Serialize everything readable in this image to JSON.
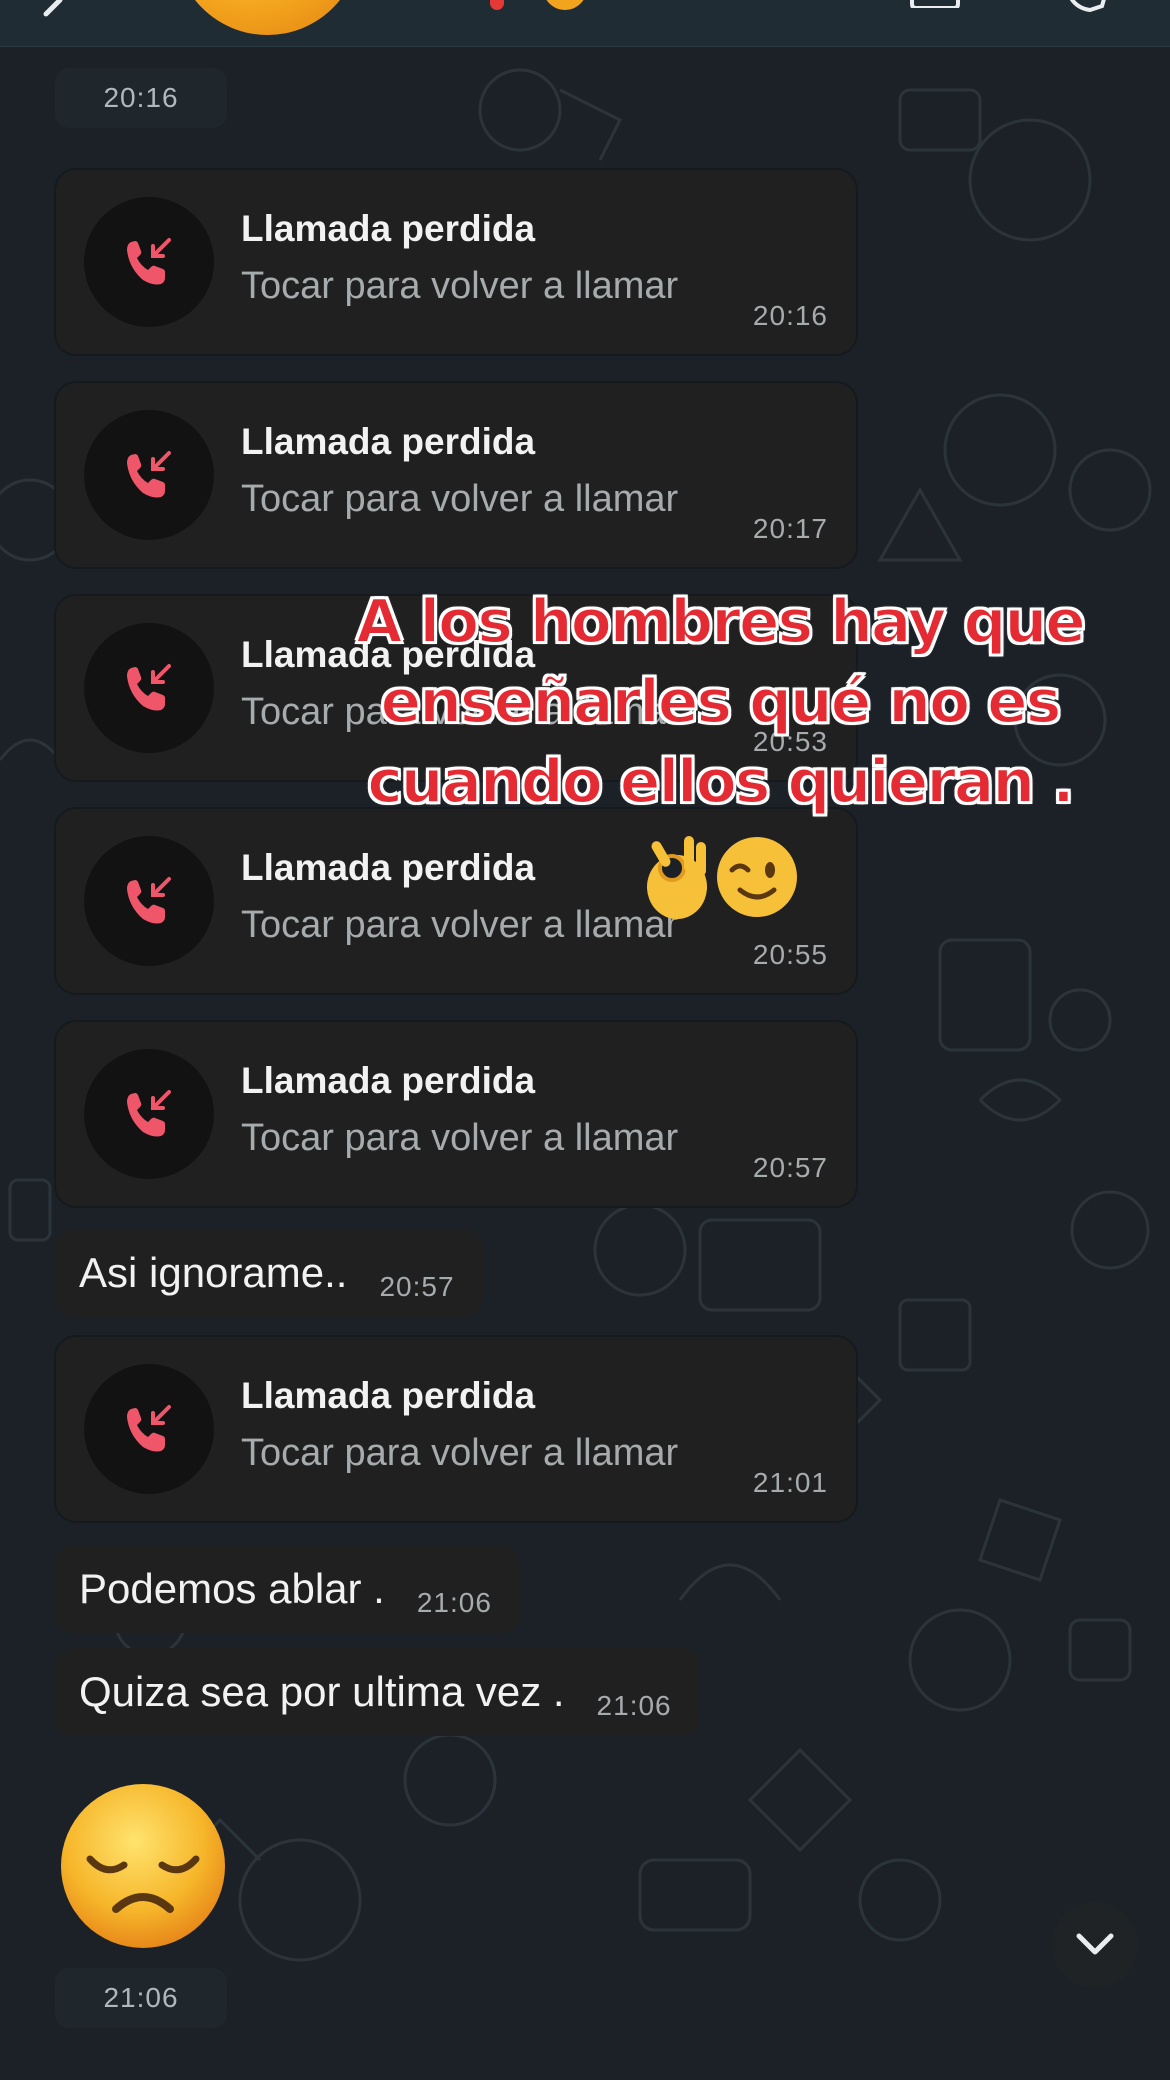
{
  "header": {
    "back_icon": "chevron-left-icon",
    "avatar_icon": "emoji-avatar",
    "video_icon": "video-camera-icon",
    "call_icon": "phone-icon"
  },
  "colors": {
    "background": "#1b2127",
    "bubble": "#202020",
    "missed_call_red": "#f0566a",
    "overlay_red": "#e42a32"
  },
  "messages": [
    {
      "type": "time",
      "time": "20:16"
    },
    {
      "type": "missed_call",
      "title": "Llamada perdida",
      "subtitle": "Tocar para volver a llamar",
      "time": "20:16"
    },
    {
      "type": "missed_call",
      "title": "Llamada perdida",
      "subtitle": "Tocar para volver a llamar",
      "time": "20:17"
    },
    {
      "type": "missed_call",
      "title": "Llamada perdida",
      "subtitle": "Tocar para volver a llamar",
      "time": "20:53"
    },
    {
      "type": "missed_call",
      "title": "Llamada perdida",
      "subtitle": "Tocar para volver a llamar",
      "time": "20:55"
    },
    {
      "type": "missed_call",
      "title": "Llamada perdida",
      "subtitle": "Tocar para volver a llamar",
      "time": "20:57"
    },
    {
      "type": "text",
      "text": "Asi ignorame..",
      "time": "20:57"
    },
    {
      "type": "missed_call",
      "title": "Llamada perdida",
      "subtitle": "Tocar para volver a llamar",
      "time": "21:01"
    },
    {
      "type": "text",
      "text": "Podemos ablar .",
      "time": "21:06"
    },
    {
      "type": "text",
      "text": "Quiza sea por ultima vez .",
      "time": "21:06"
    },
    {
      "type": "emoji",
      "icon": "disappointed-face-emoji",
      "time": "21:06"
    }
  ],
  "overlay": {
    "lines": [
      "A los hombres hay que",
      "enseñarles qué no es",
      "cuando ellos quieran ."
    ],
    "emojis": [
      "ok-hand-emoji",
      "winking-face-emoji"
    ]
  },
  "scroll_button_icon": "chevron-down-icon"
}
